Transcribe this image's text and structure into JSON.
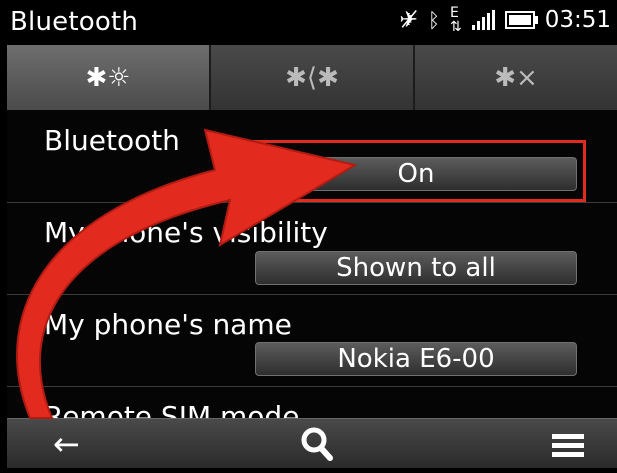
{
  "statusbar": {
    "title": "Bluetooth",
    "time": "03:51",
    "icons": [
      "no-signal-icon",
      "bluetooth-icon",
      "data-e-icon",
      "signal-icon",
      "battery-icon"
    ]
  },
  "tabs": [
    {
      "icon": "bluetooth-settings-icon",
      "glyph": "✱☼"
    },
    {
      "icon": "bluetooth-paired-icon",
      "glyph": "✱✱"
    },
    {
      "icon": "bluetooth-blocked-icon",
      "glyph": "✱×"
    }
  ],
  "settings": {
    "bluetooth": {
      "label": "Bluetooth",
      "value": "On"
    },
    "visibility": {
      "label": "My phone's visibility",
      "value": "Shown to all"
    },
    "name": {
      "label": "My phone's name",
      "value": "Nokia E6-00"
    },
    "sim": {
      "label": "Remote SIM mode"
    }
  },
  "toolbar": {
    "back_icon": "back-arrow-icon",
    "search_icon": "search-icon",
    "menu_icon": "menu-icon"
  },
  "annotation": {
    "color": "#e32a1f"
  }
}
